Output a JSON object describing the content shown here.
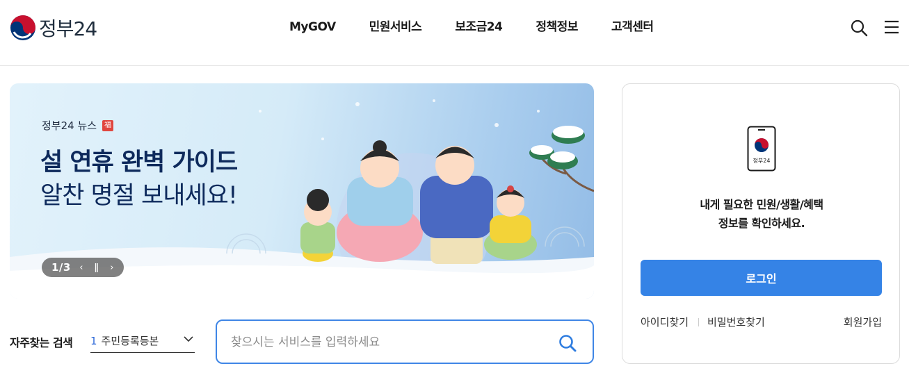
{
  "header": {
    "logo_text": "정부24",
    "nav": [
      "MyGOV",
      "민원서비스",
      "보조금24",
      "정책정보",
      "고객센터"
    ],
    "search_icon": "search-icon",
    "menu_icon": "hamburger-menu-icon"
  },
  "banner": {
    "label": "정부24 뉴스",
    "label_badge": "福",
    "headline_line1": "설 연휴 완벽 가이드",
    "headline_line2": "알찬 명절 보내세요!",
    "pager_count": "1/3",
    "prev_icon": "chevron-left-icon",
    "pause_icon": "pause-icon",
    "next_icon": "chevron-right-icon"
  },
  "search": {
    "freq_title": "자주찾는 검색",
    "freq_rank": "1",
    "freq_value": "주민등록등본",
    "placeholder": "찾으시는 서비스를 입력하세요"
  },
  "login": {
    "message_line1": "내게 필요한 민원/생활/혜택",
    "message_line2": "정보를 확인하세요.",
    "phone_label": "정부24",
    "login_button": "로그인",
    "find_id": "아이디찾기",
    "find_pw": "비밀번호찾기",
    "signup": "회원가입"
  },
  "colors": {
    "accent": "#3583e6",
    "brand_red": "#c8102e",
    "brand_blue": "#003478",
    "headline": "#0e2a5c"
  }
}
